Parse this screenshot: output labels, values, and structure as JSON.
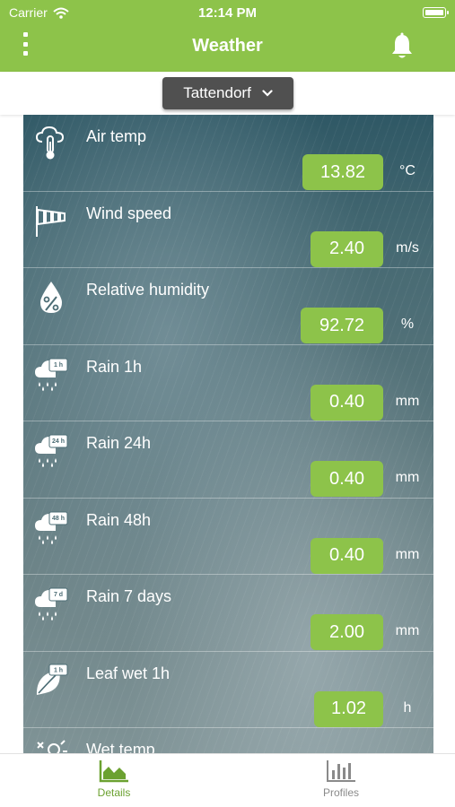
{
  "status_bar": {
    "carrier": "Carrier",
    "time": "12:14 PM"
  },
  "nav": {
    "title": "Weather",
    "menu_icon": "more-vertical-icon",
    "bell_icon": "bell-icon"
  },
  "location": {
    "selected": "Tattendorf"
  },
  "measurements": [
    {
      "label": "Air temp",
      "value": "13.82",
      "unit": "°C",
      "icon": "thermometer-cloud-icon"
    },
    {
      "label": "Wind speed",
      "value": "2.40",
      "unit": "m/s",
      "icon": "windsock-icon"
    },
    {
      "label": "Relative humidity",
      "value": "92.72",
      "unit": "%",
      "icon": "humidity-drop-icon"
    },
    {
      "label": "Rain 1h",
      "value": "0.40",
      "unit": "mm",
      "icon": "rain-cloud-icon",
      "badge": "1 h"
    },
    {
      "label": "Rain 24h",
      "value": "0.40",
      "unit": "mm",
      "icon": "rain-cloud-icon",
      "badge": "24 h"
    },
    {
      "label": "Rain 48h",
      "value": "0.40",
      "unit": "mm",
      "icon": "rain-cloud-icon",
      "badge": "48 h"
    },
    {
      "label": "Rain 7 days",
      "value": "2.00",
      "unit": "mm",
      "icon": "rain-cloud-icon",
      "badge": "7 d"
    },
    {
      "label": "Leaf wet 1h",
      "value": "1.02",
      "unit": "h",
      "icon": "leaf-wet-icon",
      "badge": "1 h"
    },
    {
      "label": "Wet temp",
      "value": "",
      "unit": "",
      "icon": "wet-temp-icon"
    }
  ],
  "tabs": [
    {
      "label": "Details",
      "icon": "area-chart-icon",
      "active": true
    },
    {
      "label": "Profiles",
      "icon": "bar-chart-icon",
      "active": false
    }
  ],
  "colors": {
    "accent": "#8dc34a",
    "active_tab": "#6ba130",
    "inactive_tab": "#8a8a8a",
    "dropdown": "#505050"
  }
}
